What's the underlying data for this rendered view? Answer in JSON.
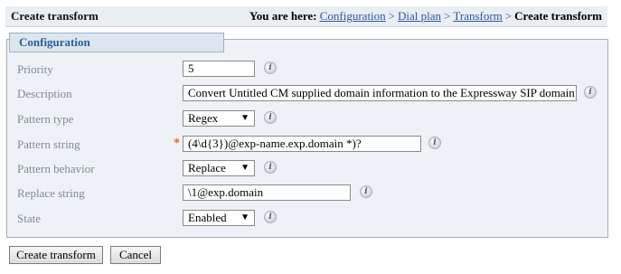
{
  "header": {
    "title": "Create transform",
    "breadcrumb": {
      "lead": "You are here:",
      "links": [
        "Configuration",
        "Dial plan",
        "Transform"
      ],
      "separator": ">",
      "current": "Create transform"
    }
  },
  "section": {
    "legend": "Configuration"
  },
  "fields": {
    "priority": {
      "label": "Priority",
      "value": "5"
    },
    "description": {
      "label": "Description",
      "value": "Convert Untitled CM supplied domain information to the Expressway SIP domain"
    },
    "pattern_type": {
      "label": "Pattern type",
      "value": "Regex"
    },
    "pattern_string": {
      "label": "Pattern string",
      "value": "(4\\d{3})@exp-name.exp.domain *)?"
    },
    "pattern_behavior": {
      "label": "Pattern behavior",
      "value": "Replace"
    },
    "replace_string": {
      "label": "Replace string",
      "value": "\\1@exp.domain"
    },
    "state": {
      "label": "State",
      "value": "Enabled"
    }
  },
  "required_marker": "*",
  "info_glyph": "i",
  "caret_glyph": "▼",
  "buttons": {
    "create": "Create transform",
    "cancel": "Cancel"
  },
  "icons": {
    "info": "info-icon",
    "caret": "chevron-down-icon"
  }
}
